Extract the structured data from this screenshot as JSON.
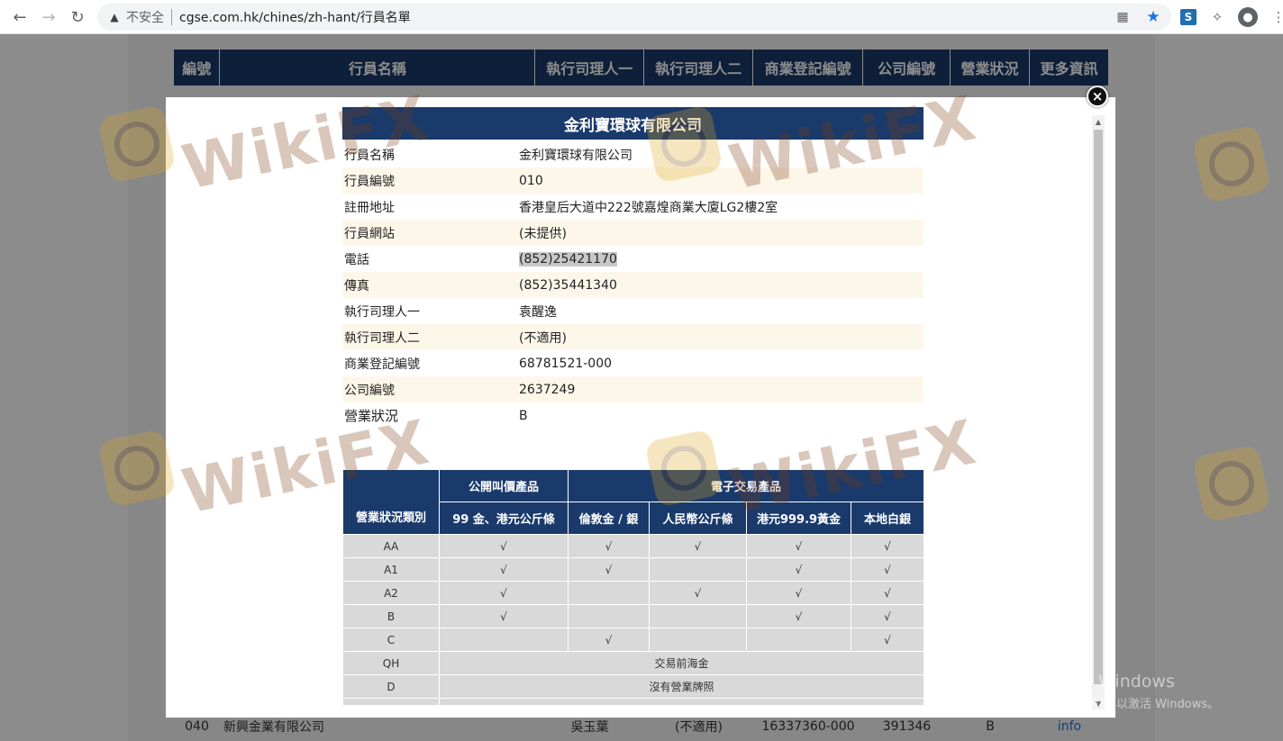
{
  "browser": {
    "insecure_label": "不安全",
    "url": "cgse.com.hk/chines/zh-hant/行員名單"
  },
  "background_table": {
    "headers": [
      "編號",
      "行員名稱",
      "執行司理人一",
      "執行司理人二",
      "商業登記編號",
      "公司編號",
      "營業狀況",
      "更多資訊"
    ],
    "bottom_row": {
      "no": "040",
      "name": "新興金業有限公司",
      "manager1": "吳玉葉",
      "manager2": "(不適用)",
      "br": "16337360-000",
      "company_no": "391346",
      "status": "B",
      "more": "info"
    }
  },
  "modal": {
    "title": "金利寶環球有限公司",
    "close_label": "×",
    "details": [
      {
        "label": "行員名稱",
        "value": "金利寶環球有限公司"
      },
      {
        "label": "行員編號",
        "value": "010"
      },
      {
        "label": "註冊地址",
        "value": "香港皇后大道中222號嘉煌商業大廈LG2樓2室"
      },
      {
        "label": "行員網站",
        "value": "(未提供)"
      },
      {
        "label": "電話",
        "value": "(852)25421170"
      },
      {
        "label": "傳真",
        "value": "(852)35441340"
      },
      {
        "label": "執行司理人一",
        "value": "袁醒逸"
      },
      {
        "label": "執行司理人二",
        "value": "(不適用)"
      },
      {
        "label": "商業登記編號",
        "value": "68781521-000"
      },
      {
        "label": "公司編號",
        "value": "2637249"
      },
      {
        "label": "營業狀況",
        "value": "B"
      }
    ],
    "status_table": {
      "corner_header": "營業狀況類別",
      "group_public": "公開叫價產品",
      "group_electronic": "電子交易產品",
      "sub_headers": [
        "99 金、港元公斤條",
        "倫敦金 / 銀",
        "人民幣公斤條",
        "港元999.9黃金",
        "本地白銀"
      ],
      "rows": [
        {
          "cat": "AA",
          "cells": [
            "√",
            "√",
            "√",
            "√",
            "√"
          ]
        },
        {
          "cat": "A1",
          "cells": [
            "√",
            "√",
            "",
            "√",
            "√"
          ]
        },
        {
          "cat": "A2",
          "cells": [
            "√",
            "",
            "√",
            "√",
            "√"
          ]
        },
        {
          "cat": "B",
          "cells": [
            "√",
            "",
            "",
            "√",
            "√"
          ]
        },
        {
          "cat": "C",
          "cells": [
            "",
            "√",
            "",
            "",
            "√"
          ]
        }
      ],
      "qh": {
        "cat": "QH",
        "text": "交易前海金"
      },
      "d": {
        "cat": "D",
        "text": "沒有營業牌照"
      }
    }
  },
  "watermark": {
    "text": "WikiFX"
  },
  "windows_activation": {
    "line1": "激活 Windows",
    "line2": "转到\"设置\"以激活 Windows。"
  },
  "colors": {
    "header_navy": "#1a3a6b",
    "row_alt": "#fdf7ea",
    "status_cell": "#d9d9d9"
  }
}
